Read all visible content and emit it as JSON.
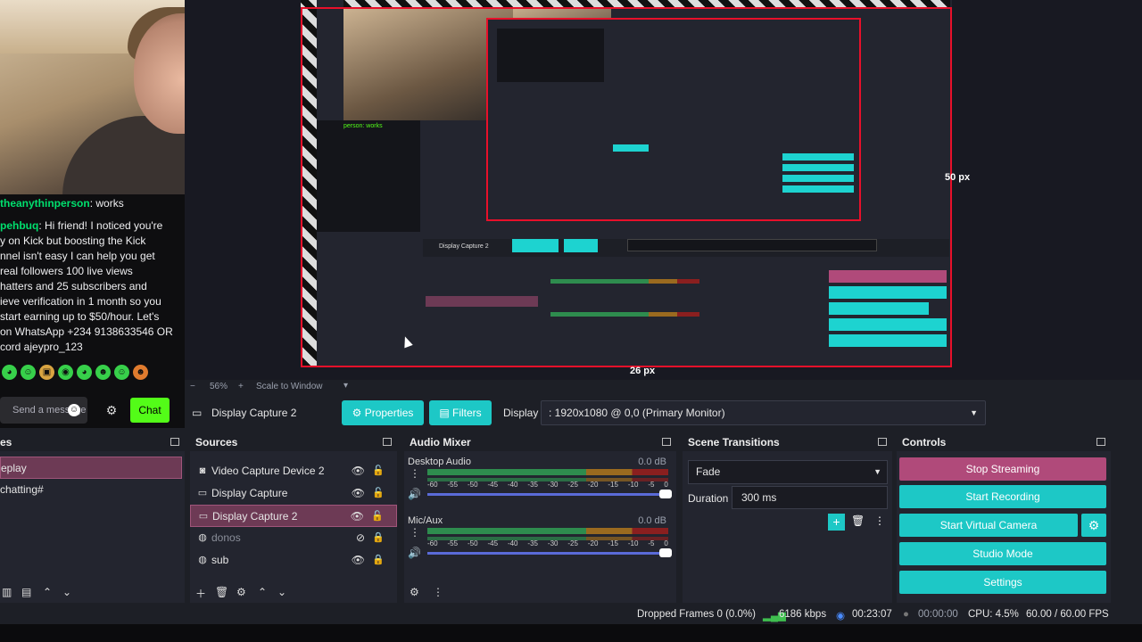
{
  "chat": {
    "line1_user": "theanythinperson",
    "line1_text": ": works",
    "line2_user": "pehbuq",
    "line2_lines": [
      ": Hi friend! I noticed you're",
      "y on Kick but boosting the Kick",
      "nnel isn't easy I can help you get",
      " real followers 100 live views",
      "hatters and 25 subscribers and",
      "ieve verification in 1 month so you",
      " start earning up to $50/hour. Let's",
      " on WhatsApp +234 9138633546 OR",
      "cord ajeypro_123"
    ],
    "send_placeholder": "Send a message",
    "chat_button": "Chat"
  },
  "preview": {
    "px_top": "50 px",
    "px_bottom": "26 px",
    "nested_chat_user": "person: works",
    "nested_display": "Display Capture 2"
  },
  "zoom": {
    "minus": "−",
    "value": "56%",
    "plus": "+",
    "scale": "Scale to Window"
  },
  "toolbar": {
    "source_name": "Display Capture 2",
    "properties": "Properties",
    "filters": "Filters",
    "display_label": "Display",
    "display_value": ": 1920x1080 @ 0,0 (Primary Monitor)"
  },
  "scenes": {
    "title": "es",
    "items": [
      "eplay",
      "chatting#"
    ]
  },
  "sources": {
    "title": "Sources",
    "items": [
      {
        "label": "Video Capture Device 2",
        "icon": "camera-icon"
      },
      {
        "label": "Display Capture",
        "icon": "monitor-icon"
      },
      {
        "label": "Display Capture 2",
        "icon": "monitor-icon"
      },
      {
        "label": "donos",
        "icon": "globe-icon"
      },
      {
        "label": "sub",
        "icon": "globe-icon"
      }
    ]
  },
  "mixer": {
    "title": "Audio Mixer",
    "channels": [
      {
        "name": "Desktop Audio",
        "db": "0.0 dB"
      },
      {
        "name": "Mic/Aux",
        "db": "0.0 dB"
      }
    ],
    "ticks": [
      "-60",
      "-55",
      "-50",
      "-45",
      "-40",
      "-35",
      "-30",
      "-25",
      "-20",
      "-15",
      "-10",
      "-5",
      "0"
    ]
  },
  "transitions": {
    "title": "Scene Transitions",
    "selected": "Fade",
    "duration_label": "Duration",
    "duration_value": "300 ms"
  },
  "controls": {
    "title": "Controls",
    "stop_streaming": "Stop Streaming",
    "start_recording": "Start Recording",
    "start_virtual_camera": "Start Virtual Camera",
    "studio_mode": "Studio Mode",
    "settings": "Settings"
  },
  "status": {
    "dropped": "Dropped Frames 0 (0.0%)",
    "kbps": "6186 kbps",
    "stream_time": "00:23:07",
    "rec_time": "00:00:00",
    "cpu": "CPU: 4.5%",
    "fps": "60.00 / 60.00 FPS"
  },
  "colors": {
    "accent": "#1dc8c6",
    "stop": "#b04a7a",
    "kick_green": "#53fc18",
    "red_outline": "#e8102a"
  }
}
